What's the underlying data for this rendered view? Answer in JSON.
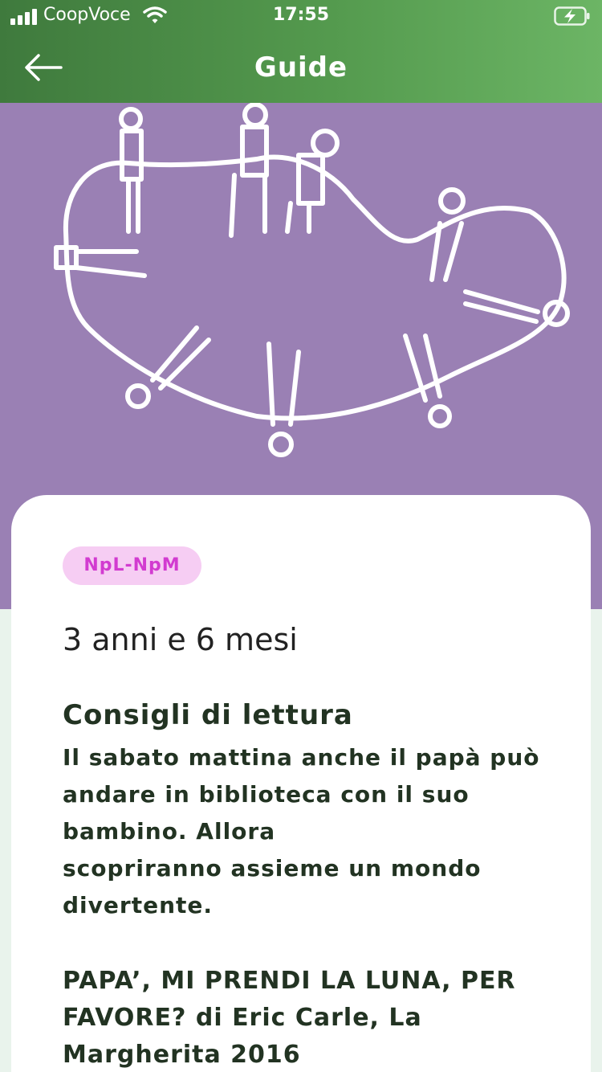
{
  "status_bar": {
    "carrier": "CoopVoce",
    "time": "17:55",
    "icons": [
      "signal-icon",
      "wifi-icon",
      "battery-charging-icon"
    ]
  },
  "nav": {
    "title": "Guide",
    "back_icon": "arrow-left-icon"
  },
  "hero": {
    "image": "children-holding-hands-drawing",
    "background_color": "#9a80b4"
  },
  "content": {
    "badge": "NpL-NpM",
    "age": "3 anni e 6 mesi",
    "section_title": "Consigli di lettura",
    "paragraph_1": "Il sabato mattina anche il papà può andare in biblioteca con il suo bambino. Allora",
    "paragraph_2": "scopriranno assieme un mondo divertente.",
    "book": "PAPA’, MI PRENDI LA LUNA, PER FAVORE? di Eric Carle, La Margherita 2016"
  },
  "colors": {
    "header_green": "#549a4e",
    "badge_bg": "#f6cdf3",
    "badge_text": "#d23bd0",
    "text_dark": "#223322"
  }
}
